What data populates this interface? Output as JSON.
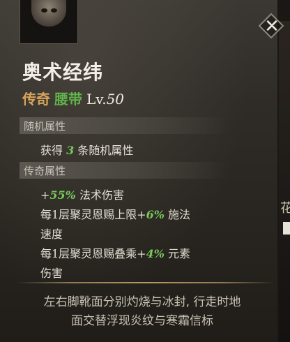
{
  "item": {
    "name": "奥术经纬",
    "rarity": "传奇",
    "type": "腰带",
    "level_prefix": "Lv.",
    "level": "50",
    "rarity_color": "#d6a45c",
    "type_color": "#5fb34a"
  },
  "sections": {
    "random": {
      "header": "随机属性",
      "line": {
        "prefix": "获得 ",
        "num": "3",
        "suffix": " 条随机属性"
      }
    },
    "legendary": {
      "header": "传奇属性",
      "lines": [
        {
          "prefix": "+",
          "num": "55%",
          "suffix": " 法术伤害"
        },
        {
          "prefix": "每1层聚灵恩赐上限+",
          "num": "6%",
          "suffix": " 施法"
        },
        {
          "prefix": "速度",
          "num": "",
          "suffix": ""
        },
        {
          "prefix": "每1层聚灵恩赐叠乘+",
          "num": "4%",
          "suffix": " 元素"
        },
        {
          "prefix": "伤害",
          "num": "",
          "suffix": ""
        }
      ]
    }
  },
  "flavor": [
    "左右脚靴面分别灼烧与冰封, 行走时地",
    "面交替浮现炎纹与寒霜信标"
  ],
  "icons": {
    "close": "close-icon",
    "portrait": "item-portrait"
  },
  "background": {
    "side_text": "花"
  },
  "colors": {
    "highlight": "#79c95c"
  }
}
